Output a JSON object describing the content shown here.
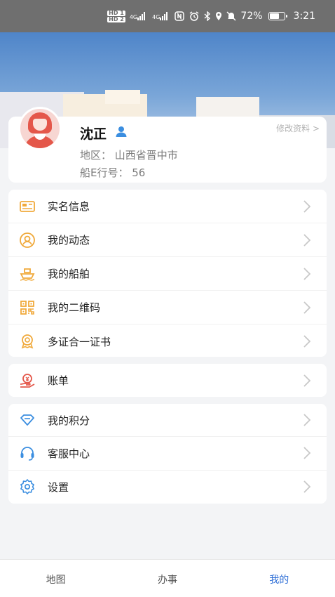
{
  "status_bar": {
    "sim_labels": [
      "HD 1",
      "HD 2"
    ],
    "network_1": "4G",
    "network_2": "4G",
    "battery_percent": "72%",
    "battery_level": 0.72,
    "time": "3:21",
    "icons": [
      "nfc-icon",
      "alarm-icon",
      "bluetooth-icon",
      "location-icon",
      "mute-icon"
    ]
  },
  "profile": {
    "name": "沈正",
    "edit_label": "修改资料 >",
    "region_line": "地区：  山西省晋中市",
    "ship_id_line": "船E行号：  56"
  },
  "menu_groups": [
    {
      "items": [
        {
          "label": "实名信息",
          "icon": "id-card-icon",
          "color": "#f0a93b"
        },
        {
          "label": "我的动态",
          "icon": "user-circle-icon",
          "color": "#f0a93b"
        },
        {
          "label": "我的船舶",
          "icon": "ship-icon",
          "color": "#f0a93b"
        },
        {
          "label": "我的二维码",
          "icon": "qr-code-icon",
          "color": "#f0a93b"
        },
        {
          "label": "多证合一证书",
          "icon": "certificate-icon",
          "color": "#f0a93b"
        }
      ]
    },
    {
      "items": [
        {
          "label": "账单",
          "icon": "bill-icon",
          "color": "#e4574a"
        }
      ]
    },
    {
      "items": [
        {
          "label": "我的积分",
          "icon": "diamond-icon",
          "color": "#3b8ee0"
        },
        {
          "label": "客服中心",
          "icon": "headset-icon",
          "color": "#3b8ee0"
        },
        {
          "label": "设置",
          "icon": "gear-icon",
          "color": "#3b8ee0"
        }
      ]
    }
  ],
  "tabbar": {
    "tabs": [
      {
        "label": "地图",
        "active": false
      },
      {
        "label": "办事",
        "active": false
      },
      {
        "label": "我的",
        "active": true
      }
    ],
    "active_color": "#2f6fd6"
  }
}
